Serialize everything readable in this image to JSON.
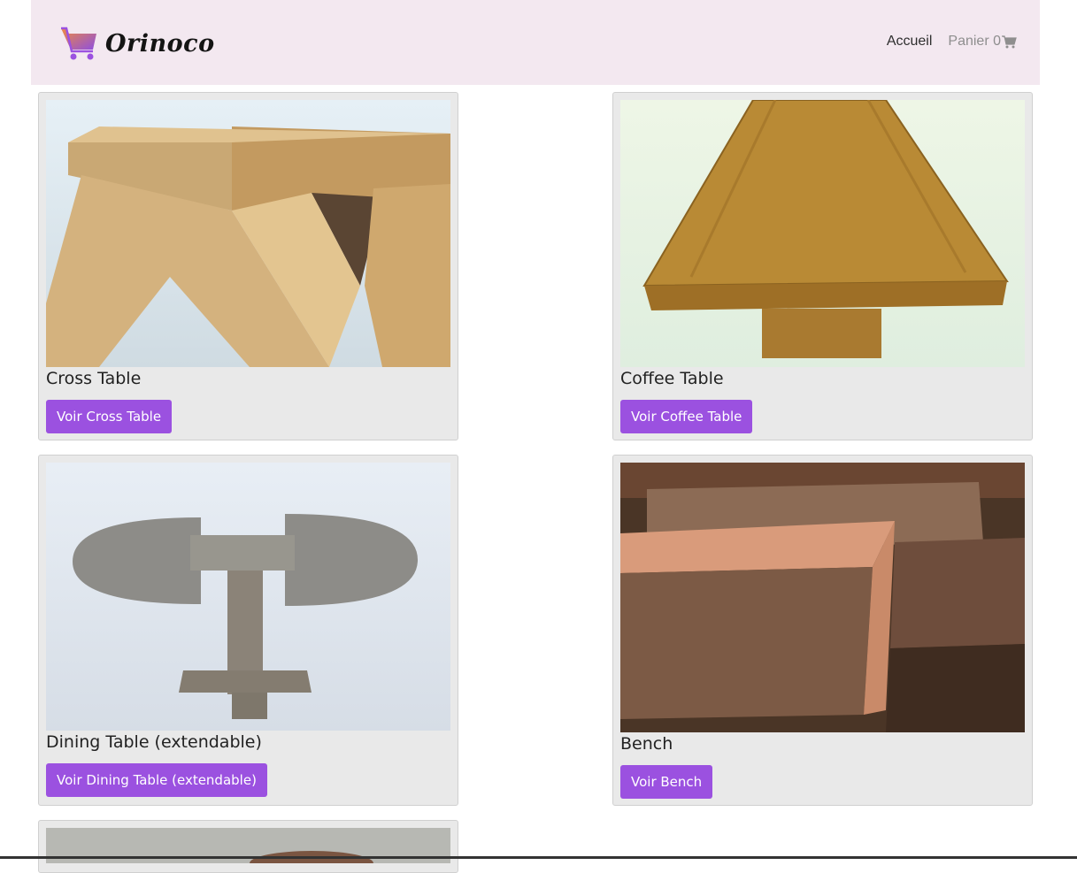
{
  "brand": {
    "name": "Orinoco",
    "logo_icon": "shopping-cart-logo-icon"
  },
  "nav": {
    "home": "Accueil",
    "cart_label": "Panier 0",
    "cart_icon": "shopping-cart-icon"
  },
  "colors": {
    "navbar_bg": "#f3e8f0",
    "card_bg": "#e9e9e9",
    "button_bg": "#9b51e0",
    "button_text": "#ffffff"
  },
  "products": [
    {
      "name": "Cross Table",
      "button": "Voir Cross Table"
    },
    {
      "name": "Coffee Table",
      "button": "Voir Coffee Table"
    },
    {
      "name": "Dining Table (extendable)",
      "button": "Voir Dining Table (extendable)"
    },
    {
      "name": "Bench",
      "button": "Voir Bench"
    }
  ]
}
